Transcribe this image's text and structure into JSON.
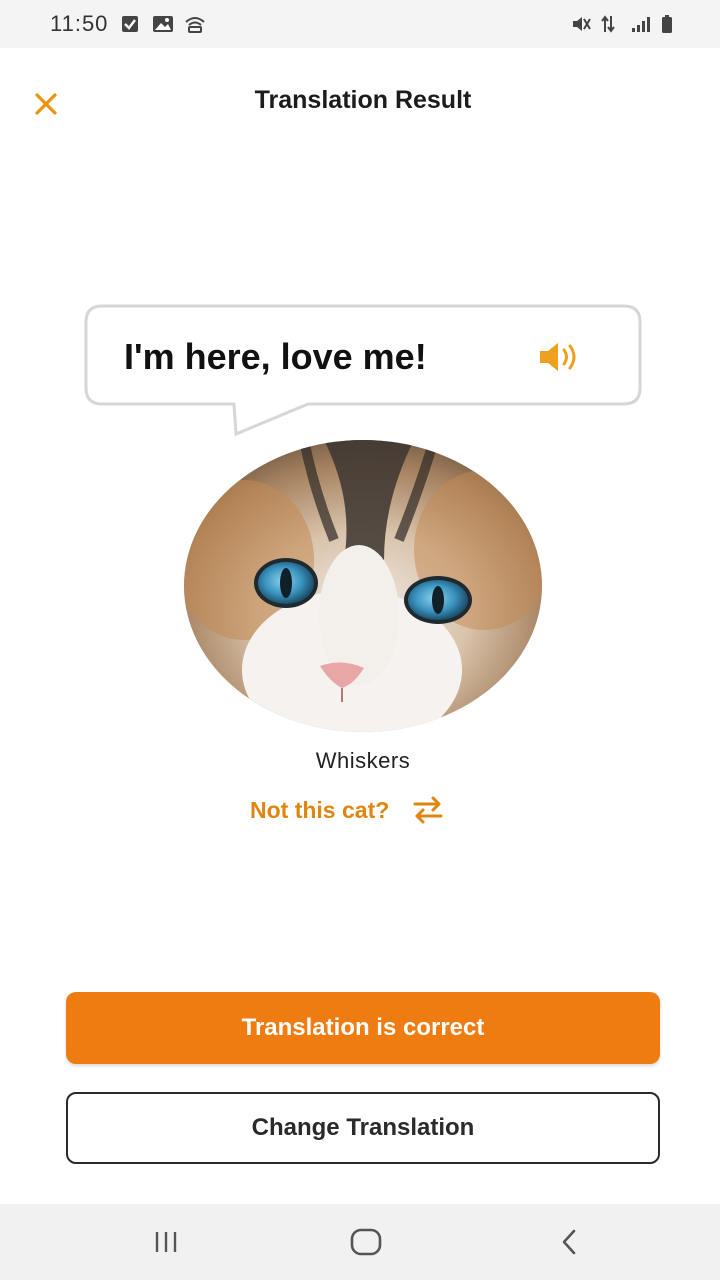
{
  "status_bar": {
    "time": "11:50",
    "left_icons": [
      "check-box-icon",
      "image-icon",
      "wifi-hotspot-icon"
    ],
    "right_icons": [
      "mute-vibrate-icon",
      "data-arrows-icon",
      "signal-icon",
      "battery-icon"
    ]
  },
  "header": {
    "title": "Translation Result",
    "close_icon": "close-icon"
  },
  "translation": {
    "text": "I'm here, love me!",
    "speaker_icon": "speaker-icon"
  },
  "cat": {
    "name": "Whiskers",
    "change_cat_label": "Not this cat?",
    "change_cat_icon": "swap-arrows-icon"
  },
  "actions": {
    "primary_label": "Translation is correct",
    "secondary_label": "Change Translation"
  },
  "nav_bar": {
    "icons": [
      "recent-apps-icon",
      "home-icon",
      "back-icon"
    ]
  },
  "colors": {
    "accent": "#ee7c10",
    "accent_text": "#e0850f",
    "bubble_border": "#d9d9d9"
  }
}
